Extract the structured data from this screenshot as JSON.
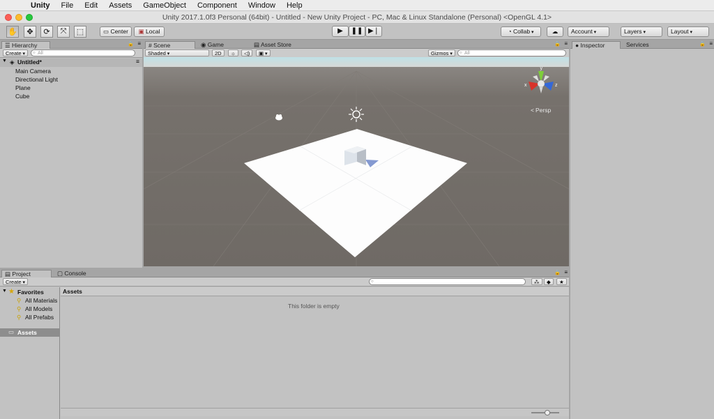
{
  "menubar": {
    "app": "Unity",
    "items": [
      "File",
      "Edit",
      "Assets",
      "GameObject",
      "Component",
      "Window",
      "Help"
    ]
  },
  "window": {
    "title": "Unity 2017.1.0f3 Personal (64bit) - Untitled - New Unity Project - PC, Mac & Linux Standalone (Personal) <OpenGL 4.1>"
  },
  "toolbar": {
    "pivot_mode": "Center",
    "pivot_rotation": "Local",
    "collab": "Collab",
    "account": "Account",
    "layers": "Layers",
    "layout": "Layout"
  },
  "hierarchy": {
    "tab": "Hierarchy",
    "create": "Create",
    "search_placeholder": "All",
    "scene_name": "Untitled*",
    "items": [
      "Main Camera",
      "Directional Light",
      "Plane",
      "Cube"
    ]
  },
  "center": {
    "tabs": [
      "Scene",
      "Game",
      "Asset Store"
    ],
    "shading": "Shaded",
    "mode_2d": "2D",
    "gizmos": "Gizmos",
    "search_placeholder": "All",
    "persp_label": "Persp",
    "axis_labels": {
      "y": "y",
      "x": "x",
      "z": "z"
    }
  },
  "inspector": {
    "tabs": [
      "Inspector",
      "Services"
    ]
  },
  "project": {
    "tabs": [
      "Project",
      "Console"
    ],
    "create": "Create",
    "favorites_label": "Favorites",
    "favorites": [
      "All Materials",
      "All Models",
      "All Prefabs"
    ],
    "assets_root": "Assets",
    "breadcrumb": "Assets",
    "empty_message": "This folder is empty"
  },
  "colors": {
    "panel": "#c2c2c2",
    "scene_ground": "#736e69",
    "selection": "#8d8d8d"
  }
}
